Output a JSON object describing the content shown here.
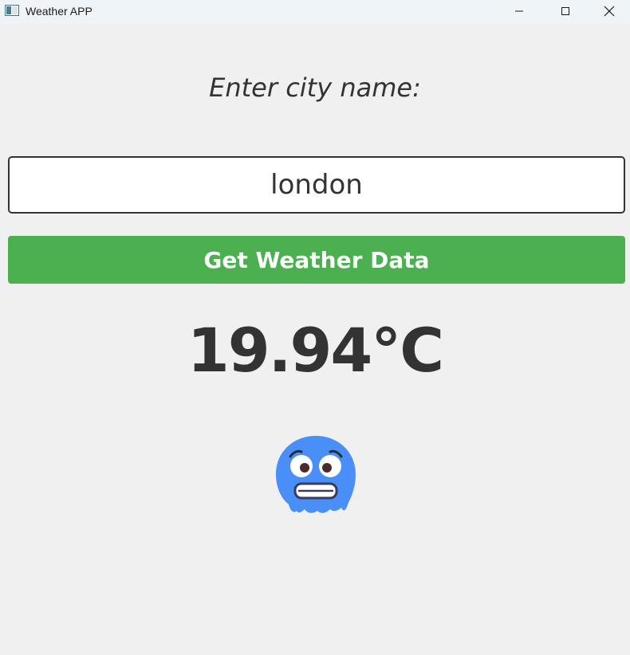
{
  "window": {
    "title": "Weather APP",
    "icon": "app-window-icon",
    "controls": [
      "minimize-icon",
      "maximize-icon",
      "close-icon"
    ]
  },
  "main": {
    "prompt": "Enter city name:",
    "city_input_value": "london",
    "get_button_label": "Get Weather Data",
    "temperature": "19.94°C",
    "weather_icon": "freezing-face-emoji"
  },
  "colors": {
    "button_bg": "#4caf50",
    "button_text": "#ffffff",
    "text": "#333333",
    "background": "#f0f0f0",
    "emoji_blue": "#4a8ff7"
  }
}
